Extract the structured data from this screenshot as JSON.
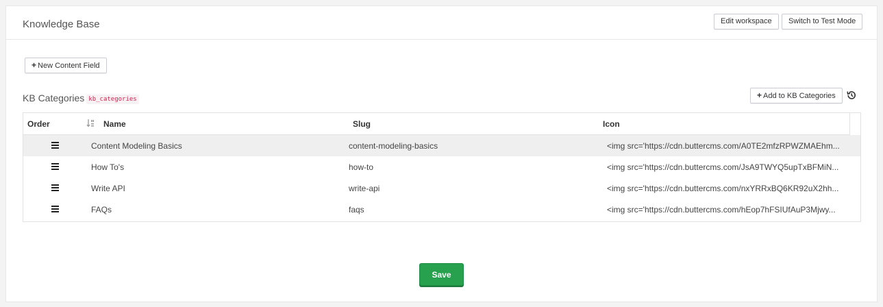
{
  "header": {
    "title": "Knowledge Base",
    "edit_workspace_label": "Edit workspace",
    "test_mode_label": "Switch to Test Mode"
  },
  "toolbar": {
    "new_field_label": "New Content Field"
  },
  "section": {
    "title": "KB Categories",
    "code": "kb_categories",
    "add_label": "Add to KB Categories",
    "history_icon": "history-icon"
  },
  "table": {
    "columns": [
      "Order",
      "Name",
      "Slug",
      "Icon"
    ],
    "rows": [
      {
        "name": "Content Modeling Basics",
        "slug": "content-modeling-basics",
        "icon": "<img src='https://cdn.buttercms.com/A0TE2mfzRPWZMAEhm...",
        "highlighted": true
      },
      {
        "name": "How To's",
        "slug": "how-to",
        "icon": "<img src='https://cdn.buttercms.com/JsA9TWYQ5upTxBFMiN...",
        "highlighted": false
      },
      {
        "name": "Write API",
        "slug": "write-api",
        "icon": "<img src='https://cdn.buttercms.com/nxYRRxBQ6KR92uX2hh...",
        "highlighted": false
      },
      {
        "name": "FAQs",
        "slug": "faqs",
        "icon": "<img src='https://cdn.buttercms.com/hEop7hFSIUfAuP3Mjwy...",
        "highlighted": false
      }
    ]
  },
  "footer": {
    "save_label": "Save"
  },
  "colors": {
    "save_green": "#27a14e",
    "highlight_row": "#efefef",
    "code_text": "#c7254e"
  }
}
